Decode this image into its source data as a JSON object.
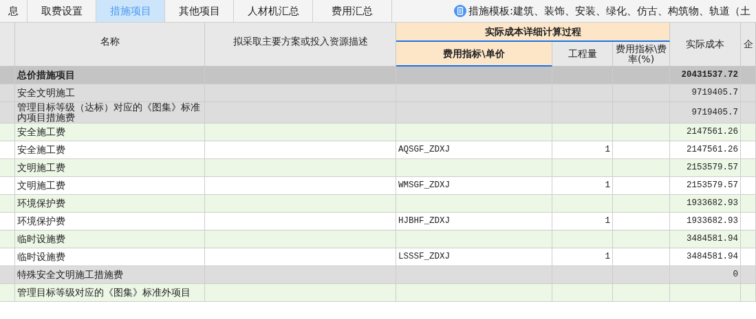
{
  "tabs": [
    {
      "label": "息",
      "selected": false
    },
    {
      "label": "取费设置",
      "selected": false
    },
    {
      "label": "措施项目",
      "selected": true
    },
    {
      "label": "其他项目",
      "selected": false
    },
    {
      "label": "人材机汇总",
      "selected": false
    },
    {
      "label": "费用汇总",
      "selected": false
    }
  ],
  "template": {
    "text": "措施模板:建筑、装饰、安装、绿化、仿古、构筑物、轨道（土"
  },
  "table": {
    "column_group": {
      "label": "实际成本详细计算过程"
    },
    "columns": [
      {
        "label": "名称",
        "selected": false
      },
      {
        "label": "拟采取主要方案或投入资源描述",
        "selected": false
      },
      {
        "label": "费用指标\\单价",
        "selected": true
      },
      {
        "label": "工程量",
        "selected": false
      },
      {
        "label": "费用指标\\费率(%)",
        "selected": false
      },
      {
        "label": "实际成本",
        "selected": false
      },
      {
        "label": "企",
        "selected": false
      }
    ],
    "rows": [
      {
        "kind": "total",
        "name": "总价措施项目",
        "cost": "20431537.72"
      },
      {
        "kind": "group",
        "name": "安全文明施工",
        "cost": "9719405.7"
      },
      {
        "kind": "group",
        "name": "管理目标等级（达标）对应的《图集》标准内项目措施费",
        "cost": "9719405.7"
      },
      {
        "kind": "subgroup",
        "name": "安全施工费",
        "cost": "2147561.26"
      },
      {
        "kind": "item",
        "name": "安全施工费",
        "unit_price": "AQSGF_ZDXJ",
        "quantity": "1",
        "cost": "2147561.26"
      },
      {
        "kind": "subgroup",
        "name": "文明施工费",
        "cost": "2153579.57"
      },
      {
        "kind": "item",
        "name": "文明施工费",
        "unit_price": "WMSGF_ZDXJ",
        "quantity": "1",
        "cost": "2153579.57"
      },
      {
        "kind": "subgroup",
        "name": "环境保护费",
        "cost": "1933682.93"
      },
      {
        "kind": "item",
        "name": "环境保护费",
        "unit_price": "HJBHF_ZDXJ",
        "quantity": "1",
        "cost": "1933682.93"
      },
      {
        "kind": "subgroup",
        "name": "临时设施费",
        "cost": "3484581.94"
      },
      {
        "kind": "item",
        "name": "临时设施费",
        "unit_price": "LSSSF_ZDXJ",
        "quantity": "1",
        "cost": "3484581.94"
      },
      {
        "kind": "group",
        "name": "特殊安全文明施工措施费",
        "cost": "0"
      },
      {
        "kind": "subgroup",
        "name": "管理目标等级对应的《图集》标准外项目"
      }
    ]
  }
}
